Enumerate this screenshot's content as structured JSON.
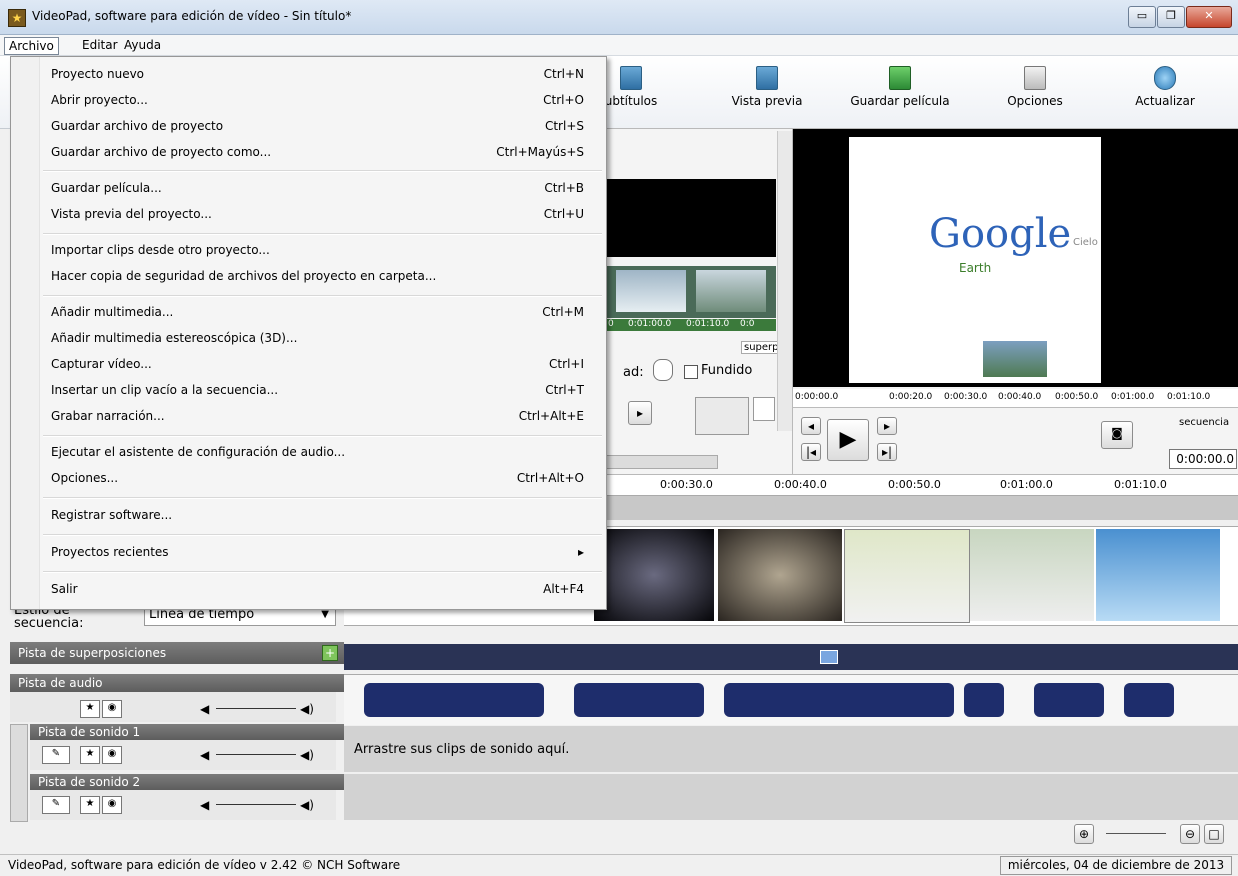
{
  "window": {
    "title": "VideoPad, software para edición de vídeo - Sin título*",
    "min": "▭",
    "max": "❐",
    "close": "✕"
  },
  "menubar": [
    "Archivo",
    "Editar",
    "Ayuda"
  ],
  "toolbar": [
    "ubtítulos",
    "Vista previa",
    "Guardar película",
    "Opciones",
    "Actualizar"
  ],
  "file_menu": {
    "items": [
      {
        "label": "Proyecto nuevo",
        "shortcut": "Ctrl+N"
      },
      {
        "label": "Abrir proyecto...",
        "shortcut": "Ctrl+O"
      },
      {
        "label": "Guardar archivo de proyecto",
        "shortcut": "Ctrl+S"
      },
      {
        "label": "Guardar archivo de proyecto como...",
        "shortcut": "Ctrl+Mayús+S"
      },
      {
        "label": "Guardar película...",
        "shortcut": "Ctrl+B"
      },
      {
        "label": "Vista previa del proyecto...",
        "shortcut": "Ctrl+U"
      },
      {
        "label": "Importar clips desde otro proyecto...",
        "shortcut": ""
      },
      {
        "label": "Hacer copia de seguridad de archivos del proyecto en carpeta...",
        "shortcut": ""
      },
      {
        "label": "Añadir multimedia...",
        "shortcut": "Ctrl+M"
      },
      {
        "label": "Añadir multimedia estereoscópica (3D)...",
        "shortcut": ""
      },
      {
        "label": "Capturar vídeo...",
        "shortcut": "Ctrl+I"
      },
      {
        "label": "Insertar un clip vacío a la secuencia...",
        "shortcut": "Ctrl+T"
      },
      {
        "label": "Grabar narración...",
        "shortcut": "Ctrl+Alt+E"
      },
      {
        "label": "Ejecutar el asistente de configuración de audio...",
        "shortcut": ""
      },
      {
        "label": "Opciones...",
        "shortcut": "Ctrl+Alt+O"
      },
      {
        "label": "Registrar software...",
        "shortcut": ""
      },
      {
        "label": "Proyectos recientes",
        "shortcut": "▸"
      },
      {
        "label": "Salir",
        "shortcut": "Alt+F4"
      }
    ]
  },
  "clip_panel": {
    "ruler": [
      "0",
      "0:01:00.0",
      "0:01:10.0",
      "0:0"
    ],
    "tab": "superp",
    "speed_label": "ad:",
    "fade_label": "Fundido"
  },
  "preview": {
    "logo_text": "Google",
    "logo_sub": "Earth",
    "logo_side": "Cielo",
    "ruler": [
      "0:00:00.0",
      "0:00:20.0",
      "0:00:30.0",
      "0:00:40.0",
      "0:00:50.0",
      "0:01:00.0",
      "0:01:10.0"
    ],
    "tab": "secuencia",
    "time": "0:00:00.0"
  },
  "timeline": {
    "ruler": [
      "0:00:30.0",
      "0:00:40.0",
      "0:00:50.0",
      "0:01:00.0",
      "0:01:10.0"
    ],
    "style_label": "Estilo de secuencia:",
    "style_value": "Línea de tiempo",
    "overlay_track": "Pista de superposiciones",
    "audio_track": "Pista de audio",
    "sound_track_1": "Pista de sonido 1",
    "sound_track_2": "Pista de sonido 2",
    "drop_hint": "Arrastre sus clips de sonido aquí."
  },
  "status": {
    "left": "VideoPad, software para edición de vídeo v 2.42 © NCH Software",
    "right": "miércoles, 04 de diciembre de 2013"
  }
}
